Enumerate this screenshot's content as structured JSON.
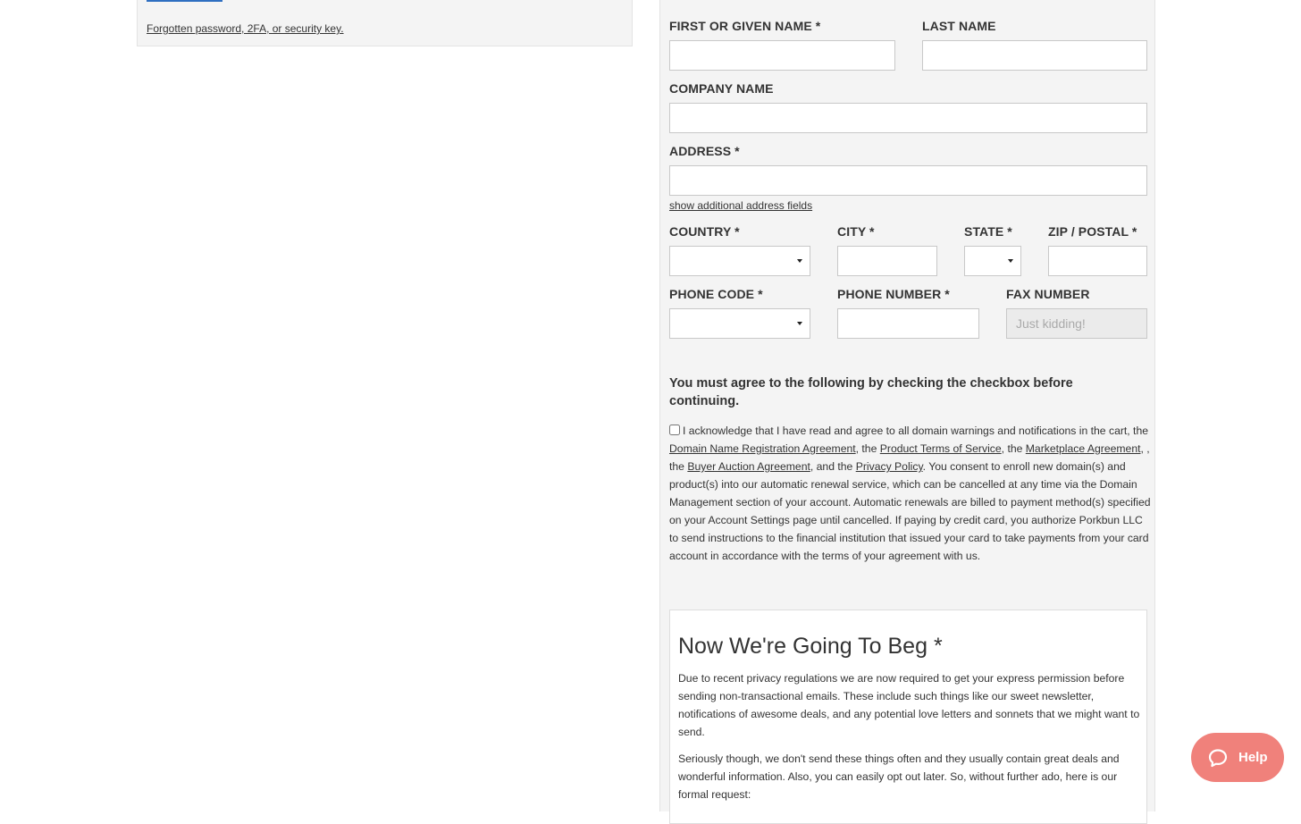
{
  "login": {
    "forgot_link": "Forgotten password, 2FA, or security key."
  },
  "form": {
    "first_name_label": "FIRST OR GIVEN NAME *",
    "last_name_label": "LAST NAME",
    "company_label": "COMPANY NAME",
    "address_label": "ADDRESS *",
    "show_address_link": "show additional address fields",
    "country_label": "COUNTRY *",
    "city_label": "CITY *",
    "state_label": "STATE *",
    "zip_label": "ZIP / POSTAL *",
    "phone_code_label": "PHONE CODE *",
    "phone_number_label": "PHONE NUMBER *",
    "fax_label": "FAX NUMBER",
    "fax_placeholder": "Just kidding!"
  },
  "agreement": {
    "heading": "You must agree to the following by checking the checkbox before continuing.",
    "text_1": "I acknowledge that I have read and agree to all domain warnings and notifications in the cart, the ",
    "link_registration": "Domain Name Registration Agreement",
    "text_2": ", the ",
    "link_terms": "Product Terms of Service",
    "text_3": ", the ",
    "link_marketplace": "Marketplace Agreement",
    "text_4": ", , the ",
    "link_auction": "Buyer Auction Agreement",
    "text_5": ", and the ",
    "link_privacy": "Privacy Policy",
    "text_6": ". You consent to enroll new domain(s) and product(s) into our automatic renewal service, which can be cancelled at any time via the Domain Management section of your account. Automatic renewals are billed to payment method(s) specified on your Account Settings page until cancelled. If paying by credit card, you authorize Porkbun LLC to send instructions to the financial institution that issued your card to take payments from your card account in accordance with the terms of your agreement with us."
  },
  "beg": {
    "title": "Now We're Going To Beg *",
    "paragraph_1": "Due to recent privacy regulations we are now required to get your express permission before sending non-transactional emails. These include such things like our sweet newsletter, notifications of awesome deals, and any potential love letters and sonnets that we might want to send.",
    "paragraph_2": "Seriously though, we don't send these things often and they usually contain great deals and wonderful information. Also, you can easily opt out later. So, without further ado, here is our formal request:"
  },
  "help": {
    "label": "Help",
    "icon": "chat-bubble-icon",
    "color": "#f0817b"
  }
}
